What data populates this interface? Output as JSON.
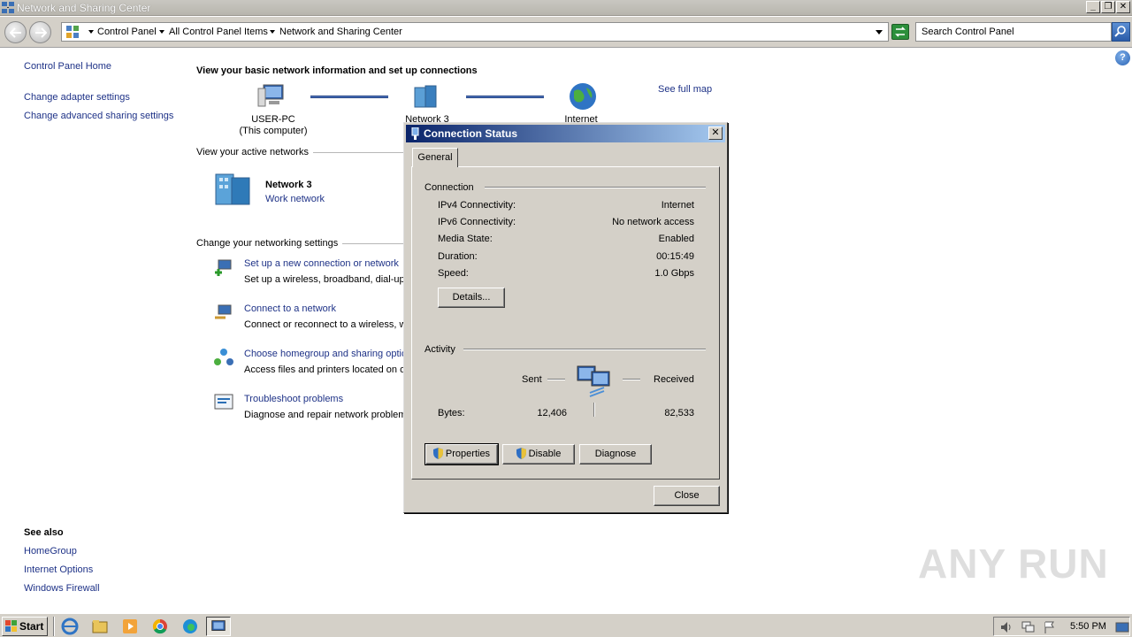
{
  "window": {
    "title": "Network and Sharing Center",
    "min": "_",
    "max": "❐",
    "close": "✕"
  },
  "address": {
    "crumbs": [
      "Control Panel",
      "All Control Panel Items",
      "Network and Sharing Center"
    ],
    "search_placeholder": "Search Control Panel"
  },
  "help": "?",
  "sidebar": {
    "home": "Control Panel Home",
    "items": [
      "Change adapter settings",
      "Change advanced sharing settings"
    ],
    "see_also_title": "See also",
    "see_also": [
      "HomeGroup",
      "Internet Options",
      "Windows Firewall"
    ]
  },
  "main": {
    "title": "View your basic network information and set up connections",
    "map": {
      "computer": "USER-PC",
      "computer_sub": "(This computer)",
      "network": "Network  3",
      "internet": "Internet",
      "full_map": "See full map"
    },
    "active_header": "View your active networks",
    "network_name": "Network  3",
    "network_type": "Work network",
    "settings_header": "Change your networking settings",
    "tasks": [
      {
        "link": "Set up a new connection or network",
        "desc": "Set up a wireless, broadband, dial-up"
      },
      {
        "link": "Connect to a network",
        "desc": "Connect or reconnect to a wireless, w"
      },
      {
        "link": "Choose homegroup and sharing optio",
        "desc": "Access files and printers located on ot"
      },
      {
        "link": "Troubleshoot problems",
        "desc": "Diagnose and repair network problem"
      }
    ]
  },
  "dialog": {
    "title": "Connection Status",
    "close": "✕",
    "tab": "General",
    "connection_label": "Connection",
    "rows": [
      {
        "label": "IPv4 Connectivity:",
        "value": "Internet"
      },
      {
        "label": "IPv6 Connectivity:",
        "value": "No network access"
      },
      {
        "label": "Media State:",
        "value": "Enabled"
      },
      {
        "label": "Duration:",
        "value": "00:15:49"
      },
      {
        "label": "Speed:",
        "value": "1.0 Gbps"
      }
    ],
    "details_button": "Details...",
    "activity_label": "Activity",
    "sent": "Sent",
    "received": "Received",
    "bytes_label": "Bytes:",
    "bytes_sent": "12,406",
    "bytes_received": "82,533",
    "properties_button": "Properties",
    "disable_button": "Disable",
    "diagnose_button": "Diagnose",
    "close_button": "Close"
  },
  "taskbar": {
    "start": "Start",
    "clock": "5:50 PM"
  },
  "watermark": "ANY RUN",
  "colors": {
    "link": "#1e3287",
    "dialog_title_start": "#0a246a",
    "dialog_title_end": "#a6caf0",
    "face": "#d4d0c8"
  }
}
